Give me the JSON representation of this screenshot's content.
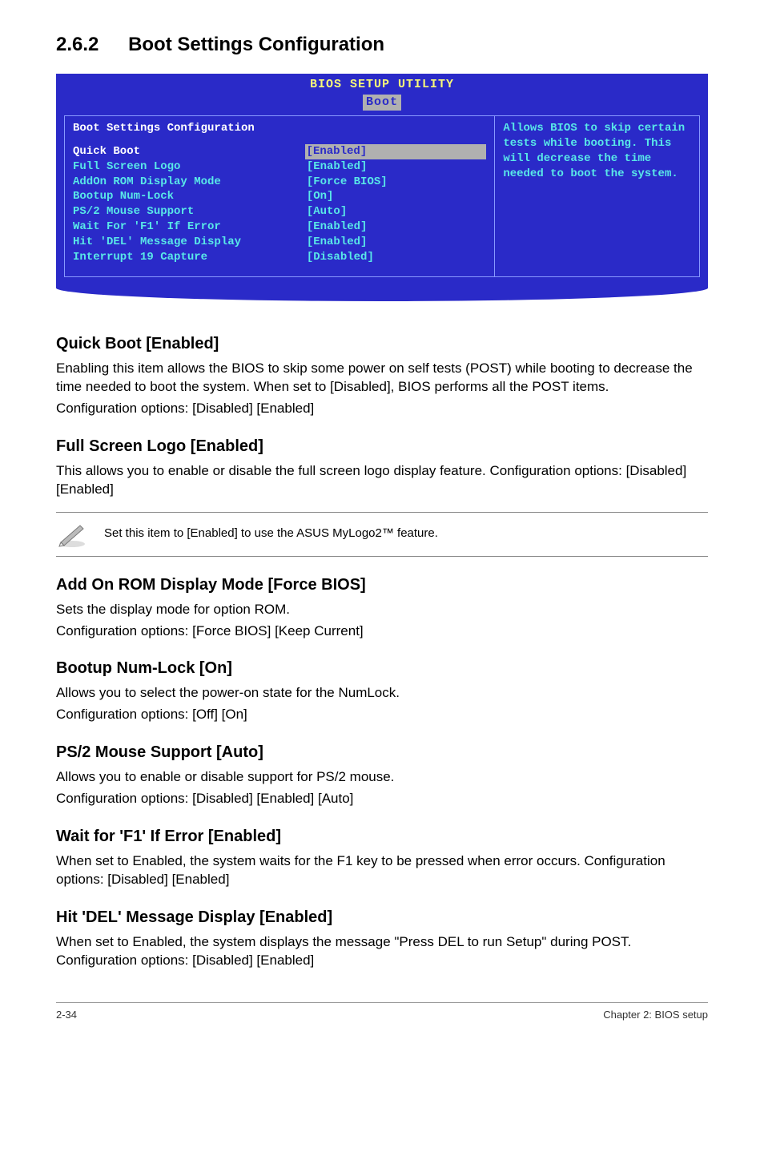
{
  "section": {
    "number": "2.6.2",
    "title": "Boot Settings Configuration"
  },
  "bios": {
    "header": "BIOS SETUP UTILITY",
    "tab": "Boot",
    "panel_title": "Boot Settings Configuration",
    "help_text": "Allows BIOS to skip certain tests while booting. This will decrease the time needed to boot the system.",
    "rows": [
      {
        "label": "Quick Boot",
        "value": "[Enabled]",
        "selected": true
      },
      {
        "label": "Full Screen Logo",
        "value": "[Enabled]",
        "selected": false
      },
      {
        "label": "AddOn ROM Display Mode",
        "value": "[Force BIOS]",
        "selected": false
      },
      {
        "label": "Bootup Num-Lock",
        "value": "[On]",
        "selected": false
      },
      {
        "label": "PS/2 Mouse Support",
        "value": "[Auto]",
        "selected": false
      },
      {
        "label": "Wait For 'F1' If Error",
        "value": "[Enabled]",
        "selected": false
      },
      {
        "label": "Hit 'DEL' Message Display",
        "value": "[Enabled]",
        "selected": false
      },
      {
        "label": "Interrupt 19 Capture",
        "value": "[Disabled]",
        "selected": false
      }
    ]
  },
  "items": {
    "quick_boot": {
      "head": "Quick Boot [Enabled]",
      "p1": "Enabling this item allows the BIOS to skip some power on self tests (POST) while booting to decrease the time needed to boot the system. When set to [Disabled], BIOS performs all the POST items.",
      "p2": "Configuration options: [Disabled] [Enabled]"
    },
    "full_screen_logo": {
      "head": "Full Screen Logo [Enabled]",
      "p1": "This allows you to enable or disable the full screen logo display feature. Configuration options: [Disabled] [Enabled]"
    },
    "note": "Set this item to [Enabled] to use the ASUS MyLogo2™ feature.",
    "addon_rom": {
      "head": "Add On ROM Display Mode [Force BIOS]",
      "p1": "Sets the display mode for option ROM.",
      "p2": "Configuration options: [Force BIOS] [Keep Current]"
    },
    "numlock": {
      "head": "Bootup Num-Lock [On]",
      "p1": "Allows you to select the power-on state for the NumLock.",
      "p2": "Configuration options: [Off] [On]"
    },
    "ps2": {
      "head": "PS/2 Mouse Support [Auto]",
      "p1": "Allows you to enable or disable support for PS/2 mouse.",
      "p2": "Configuration options: [Disabled] [Enabled] [Auto]"
    },
    "wait_f1": {
      "head": "Wait for 'F1' If Error [Enabled]",
      "p1": "When set to Enabled, the system waits for the F1 key to be pressed when error occurs. Configuration options: [Disabled] [Enabled]"
    },
    "hit_del": {
      "head": "Hit 'DEL' Message Display [Enabled]",
      "p1": "When set to Enabled, the system displays the message \"Press DEL to run Setup\" during POST. Configuration options: [Disabled] [Enabled]"
    }
  },
  "footer": {
    "left": "2-34",
    "right": "Chapter 2: BIOS setup"
  }
}
